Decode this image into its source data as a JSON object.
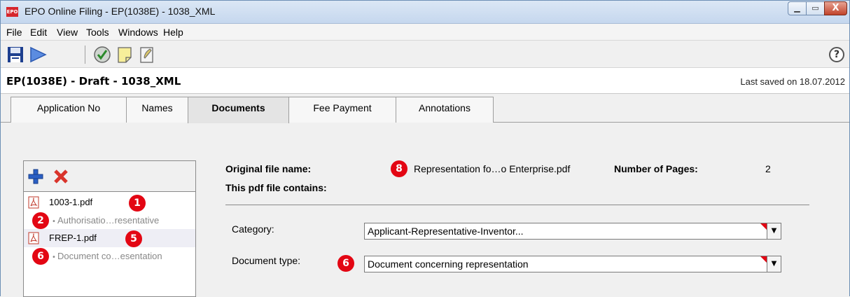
{
  "window": {
    "app_icon": "EPO",
    "title": "EPO Online Filing  - EP(1038E) - 1038_XML",
    "minimize": "▁",
    "maximize": "▭",
    "close": "X"
  },
  "menu": [
    "File",
    "Edit",
    "View",
    "Tools",
    "Windows",
    "Help"
  ],
  "toolbar": {
    "icons": [
      "save-icon",
      "play-icon",
      "validate-icon",
      "note-icon",
      "sign-icon"
    ],
    "help": "?"
  },
  "header": {
    "title": "EP(1038E) - Draft - 1038_XML",
    "last_saved": "Last saved on 18.07.2012"
  },
  "tabs": [
    {
      "label": "Application No",
      "active": false
    },
    {
      "label": "Names",
      "active": false
    },
    {
      "label": "Documents",
      "active": true
    },
    {
      "label": "Fee Payment",
      "active": false
    },
    {
      "label": "Annotations",
      "active": false
    }
  ],
  "documents": {
    "items": [
      {
        "file": "1003-1.pdf",
        "marker": "1",
        "sub": "Authorisatio…resentative",
        "sub_marker": "2"
      },
      {
        "file": "FREP-1.pdf",
        "marker": "5",
        "sub": "Document co…esentation",
        "sub_marker": "6"
      }
    ]
  },
  "details": {
    "original_label": "Original file name:",
    "original_marker": "8",
    "original_value": "Representation fo…o Enterprise.pdf",
    "pages_label": "Number of Pages:",
    "pages_value": "2",
    "contains_label": "This pdf file contains:",
    "category_label": "Category:",
    "category_value": "Applicant-Representative-Inventor...",
    "doctype_label": "Document type:",
    "doctype_marker": "6",
    "doctype_value": "Document concerning representation"
  },
  "colors": {
    "marker": "#e30613",
    "active_tab": "#e4e4e4",
    "titlebar": "#c5d7ee"
  }
}
